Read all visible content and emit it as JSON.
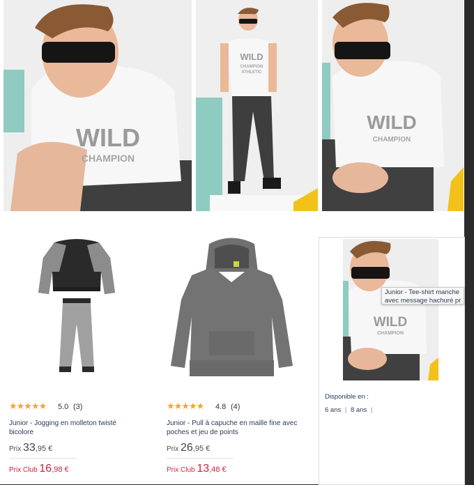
{
  "hero_images": [
    {
      "name": "boy-sitting-closeup-photo"
    },
    {
      "name": "boy-standing-full-photo"
    },
    {
      "name": "boy-sitting-photo"
    }
  ],
  "tshirt_print": {
    "line1": "WILD",
    "line2": "CHAMPION",
    "line3": "ATHLETIC"
  },
  "products": [
    {
      "image": "jogging-set-photo",
      "stars": "★★★★★",
      "rating": "5.0",
      "reviews": "(3)",
      "title_line1": "Junior - Jogging en molleton twisté",
      "title_line2": "bicolore",
      "price_label": "Prix",
      "price_int": "33",
      "price_dec": ",95 €",
      "club_label": "Prix Club",
      "club_int": "16",
      "club_dec": ",98 €"
    },
    {
      "image": "grey-hoodie-photo",
      "stars": "★★★★★",
      "rating": "4.8",
      "reviews": "(4)",
      "title_line1": "Junior - Pull à capuche en maille fine avec",
      "title_line2": "poches et jeu de points",
      "price_label": "Prix",
      "price_int": "26",
      "price_dec": ",95 €",
      "club_label": "Prix Club",
      "club_int": "13",
      "club_dec": ",48 €"
    }
  ],
  "side_card": {
    "image": "boy-tshirt-photo",
    "tooltip_line1": "Junior - Tee-shirt manche",
    "tooltip_line2": "avec message hachuré pr",
    "available_label": "Disponible en :",
    "sizes": [
      "6 ans",
      "8 ans"
    ],
    "separator": "|"
  },
  "colors": {
    "star": "#f5a623",
    "club_price": "#d0203c",
    "title_text": "#2b3a55"
  }
}
